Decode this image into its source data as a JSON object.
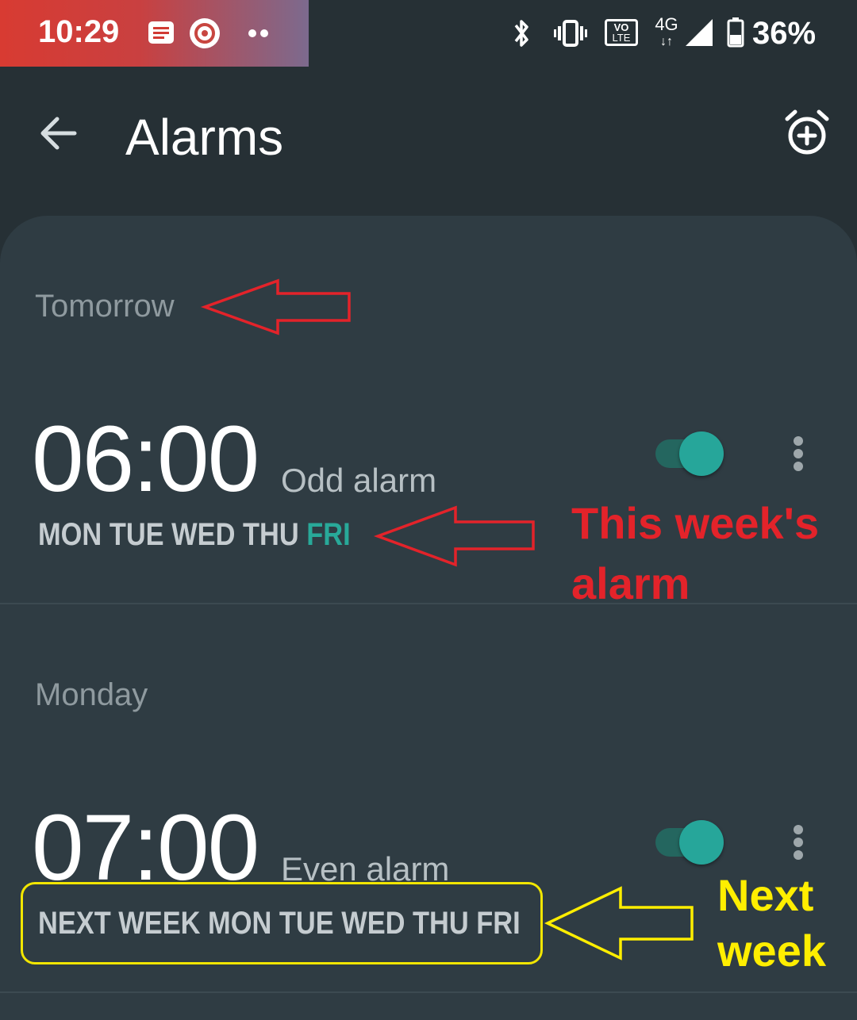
{
  "status_bar": {
    "time": "10:29",
    "battery": "36%",
    "network": "4G",
    "volte": "VO",
    "volte_sub": "LTE",
    "gradient_colors": [
      "#d83b32",
      "#7c6a8e"
    ]
  },
  "app_bar": {
    "title": "Alarms",
    "back_icon": "arrow-left-icon",
    "add_icon": "alarm-add-icon"
  },
  "alarms": [
    {
      "section": "Tomorrow",
      "time": "06:00",
      "label": "Odd alarm",
      "days_prefix": "MON TUE WED THU ",
      "days_active": "FRI",
      "enabled": true
    },
    {
      "section": "Monday",
      "time": "07:00",
      "label": "Even alarm",
      "days": "NEXT WEEK MON TUE WED THU FRI",
      "enabled": true
    }
  ],
  "annotations": {
    "this_week_line1": "This week's",
    "this_week_line2": "alarm",
    "next_week_line1": "Next",
    "next_week_line2": "week",
    "red_color": "#e3232a",
    "yellow_color": "#ffee00"
  },
  "colors": {
    "background": "#263035",
    "card": "#2f3c43",
    "accent": "#26a69a"
  }
}
